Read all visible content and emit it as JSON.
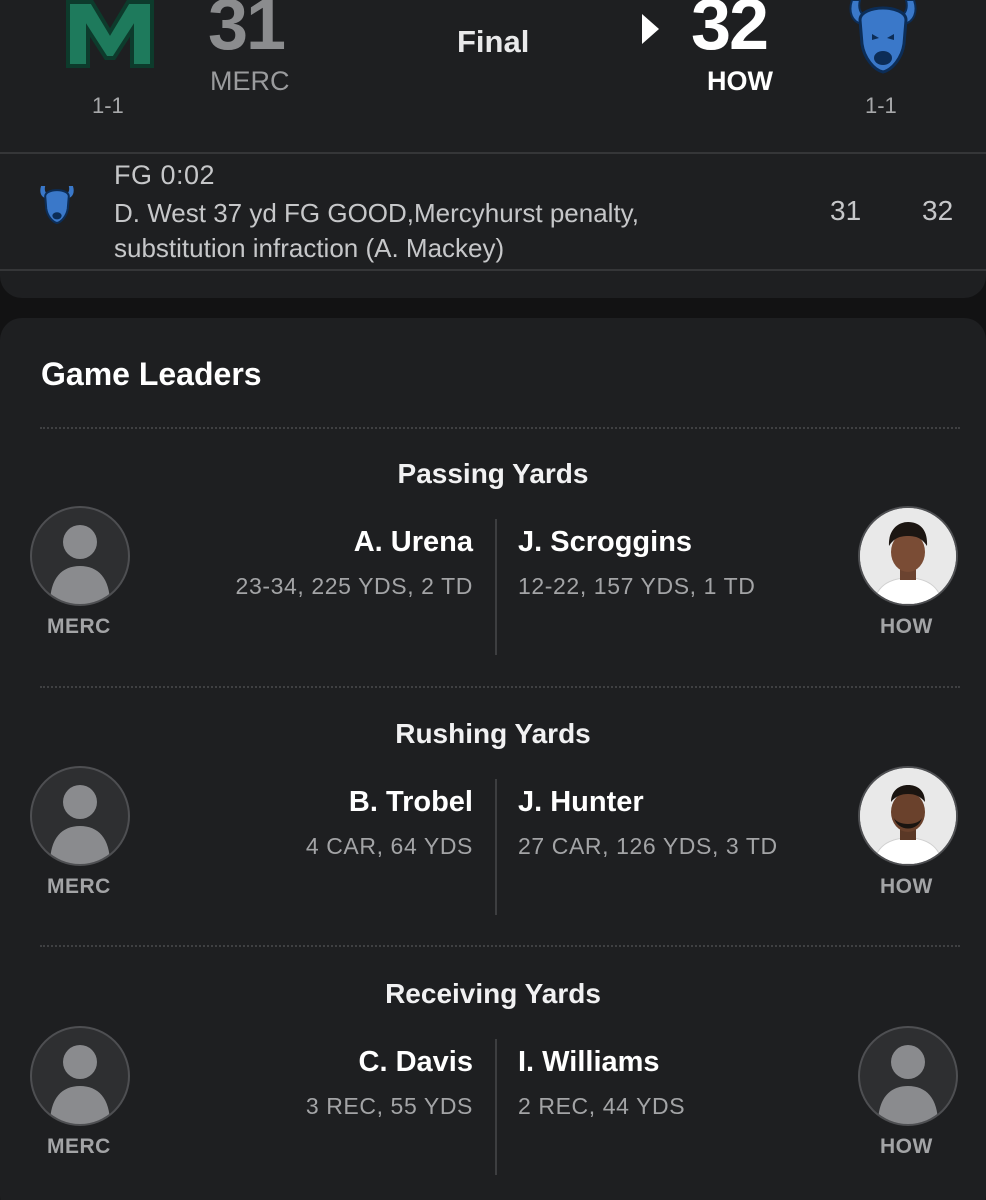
{
  "scoreboard": {
    "home": {
      "abbr": "MERC",
      "score": "31",
      "record": "1-1",
      "logo_icon": "mercyhurst-m-logo",
      "color": "#1e7a5c"
    },
    "away": {
      "abbr": "HOW",
      "score": "32",
      "record": "1-1",
      "logo_icon": "howard-bison-logo",
      "color": "#0f3a6e"
    },
    "status": "Final",
    "winner_indicator_icon": "caret-right-icon"
  },
  "last_play": {
    "type": "FG 0:02",
    "description": "D. West 37 yd FG GOOD,Mercyhurst penalty, substitution infraction (A. Mackey)",
    "home_score": "31",
    "away_score": "32",
    "team_logo_icon": "howard-bison-logo"
  },
  "leaders": {
    "title": "Game Leaders",
    "categories": [
      {
        "name": "Passing Yards",
        "left": {
          "player": "A. Urena",
          "stat": "23-34, 225 YDS, 2 TD",
          "team": "MERC",
          "avatar": "placeholder-silhouette"
        },
        "right": {
          "player": "J. Scroggins",
          "stat": "12-22, 157 YDS, 1 TD",
          "team": "HOW",
          "avatar": "player-headshot"
        }
      },
      {
        "name": "Rushing Yards",
        "left": {
          "player": "B. Trobel",
          "stat": "4 CAR, 64 YDS",
          "team": "MERC",
          "avatar": "placeholder-silhouette"
        },
        "right": {
          "player": "J. Hunter",
          "stat": "27 CAR, 126 YDS, 3 TD",
          "team": "HOW",
          "avatar": "player-headshot"
        }
      },
      {
        "name": "Receiving Yards",
        "left": {
          "player": "C. Davis",
          "stat": "3 REC, 55 YDS",
          "team": "MERC",
          "avatar": "placeholder-silhouette"
        },
        "right": {
          "player": "I. Williams",
          "stat": "2 REC, 44 YDS",
          "team": "HOW",
          "avatar": "placeholder-silhouette"
        }
      }
    ]
  }
}
